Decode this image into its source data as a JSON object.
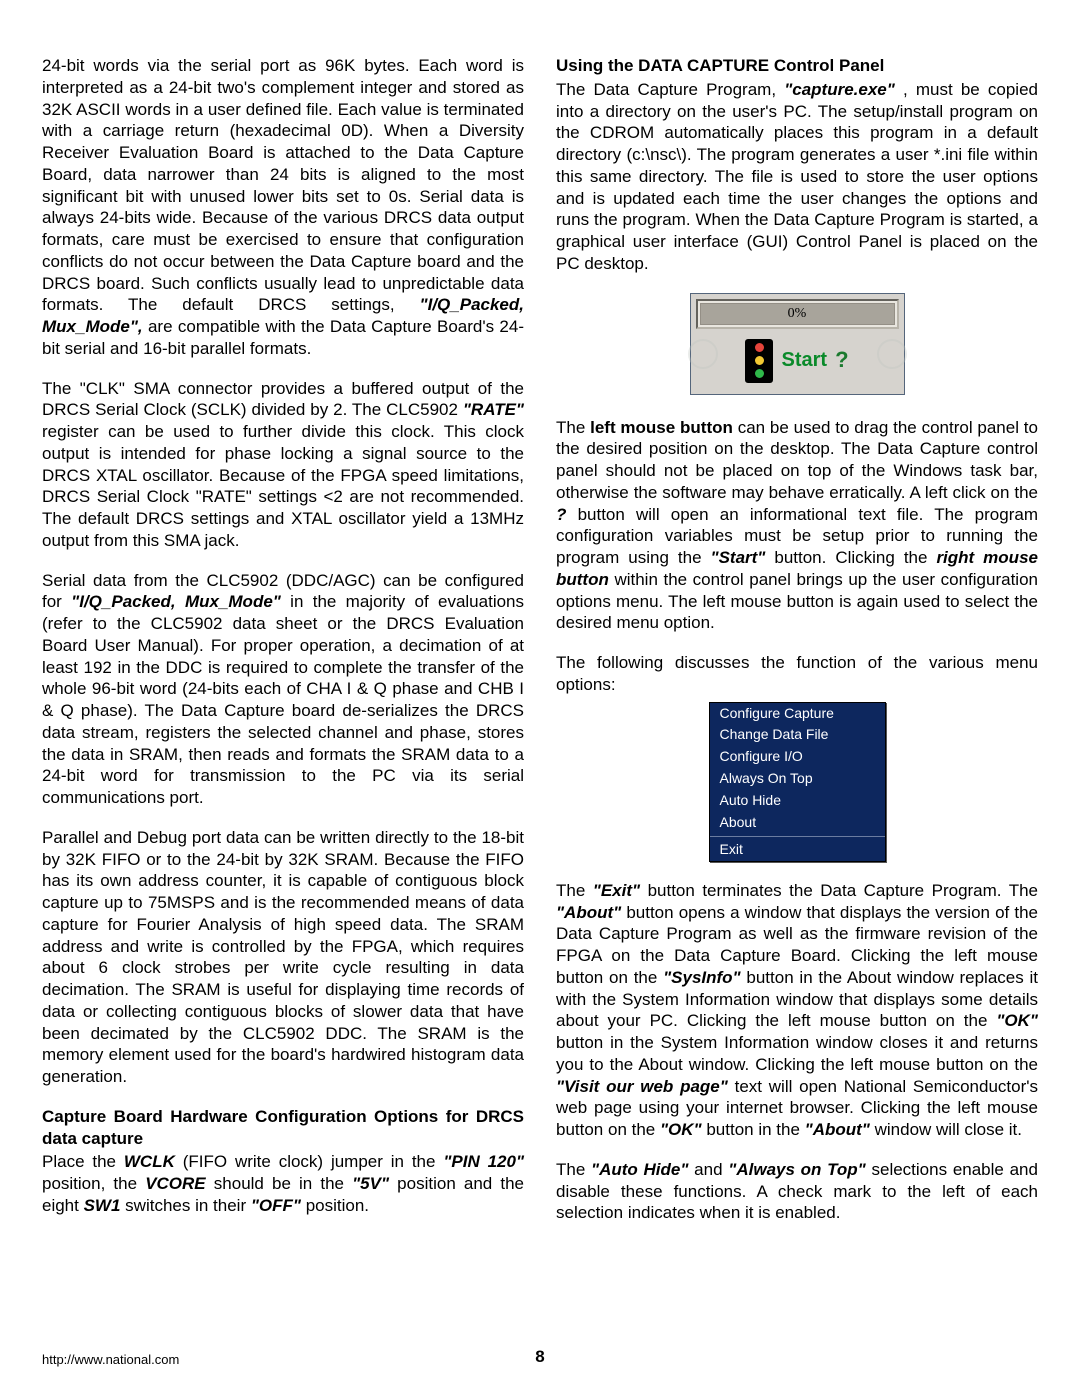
{
  "left": {
    "p1": {
      "t1": "24-bit words via the serial port as 96K bytes. Each word is interpreted as a 24-bit two's complement integer and stored as 32K ASCII words in a user defined file. Each value is terminated with a carriage return (hexadecimal 0D). When a Diversity Receiver Evaluation Board is attached to the Data Capture Board, data narrower than 24 bits is aligned to the most significant bit with unused lower bits set to 0s. Serial data is always 24-bits wide. Because of the various DRCS data output formats, care must be exercised to ensure that configuration conflicts do not occur between the Data Capture board and the DRCS board. Such conflicts usually lead to unpredictable data formats. The default DRCS settings, ",
      "bi1": "\"I/Q_Packed, Mux_Mode\",",
      "t2": " are compatible with the Data Capture Board's 24-bit serial and 16-bit parallel formats."
    },
    "p2": {
      "t1": "The \"CLK\" SMA connector provides a buffered output of the DRCS Serial Clock (SCLK) divided by 2. The CLC5902 ",
      "bi1": "\"RATE\"",
      "t2": " register can be used to further divide this clock. This clock output is intended for phase locking a signal source to the DRCS XTAL oscillator. Because of the FPGA speed limitations, DRCS Serial Clock \"RATE\" settings <2 are not recommended. The default DRCS settings and XTAL oscillator yield a 13MHz output from this SMA jack."
    },
    "p3": {
      "t1": "Serial data from the CLC5902 (DDC/AGC) can be configured for ",
      "bi1": "\"I/Q_Packed, Mux_Mode\"",
      "t2": " in the majority of evaluations (refer to the CLC5902 data sheet or the DRCS Evaluation Board User Manual). For proper operation, a decimation of at least 192 in the DDC is required to complete the transfer of the whole 96-bit word (24-bits each of CHA I & Q phase and CHB I & Q phase). The Data Capture board de-serializes the DRCS data stream, registers the selected channel and phase, stores the data in SRAM, then reads and formats the SRAM data to a 24-bit word for transmission to the PC via its serial communications port."
    },
    "p4": "Parallel and Debug port data can be written directly to the 18-bit by 32K FIFO or to the 24-bit by 32K SRAM. Because the FIFO has its own address counter, it is capable of contiguous block capture up to 75MSPS and is the recommended means of data capture for Fourier Analysis of high speed data. The SRAM address and write is controlled by the FPGA, which requires about 6 clock strobes per write cycle resulting in data decimation. The SRAM is useful for displaying time records of data or collecting contiguous blocks of slower data that have been decimated by the CLC5902 DDC. The SRAM is the memory element used for the board's hardwired histogram data generation.",
    "h1": "Capture Board Hardware Configuration Options for DRCS data capture",
    "p5": {
      "t1": "Place the ",
      "bi1": "WCLK",
      "t2": " (FIFO write clock) jumper in the ",
      "bi2": "\"PIN 120\"",
      "t3": " position, the ",
      "bi3": "VCORE",
      "t4": " should be in the ",
      "bi4": "\"5V\"",
      "t5": " position and the eight ",
      "bi5": "SW1",
      "t6": " switches in their ",
      "bi6": "\"OFF\"",
      "t7": " position."
    }
  },
  "right": {
    "h1": "Using the DATA CAPTURE Control Panel",
    "p1": {
      "t1": "The Data Capture Program, ",
      "bi1": "\"capture.exe\"",
      "t2": ", must be copied into a directory on the user's PC. The setup/install program on the CDROM automatically places this program in a default directory (c:\\nsc\\). The program generates a user *.ini file within this same directory. The file is used to store the user options and is updated each time the user changes the options and runs the program. When the Data Capture Program is started, a graphical user interface (GUI) Control Panel is placed on the PC desktop."
    },
    "panel": {
      "progress": "0%",
      "start": "Start",
      "help": "?"
    },
    "p2": {
      "t1": "The ",
      "b1": "left mouse button",
      "t2": " can be used to drag the control panel to the desired position on the desktop. The Data Capture control panel should not be placed on top of the Windows task bar, otherwise the software may behave erratically. A left click on the ",
      "bi1": "?",
      "t3": " button will open an informational text file. The program configuration variables must be setup prior to running the program using the ",
      "bi2": "\"Start\"",
      "t4": " button. Clicking the ",
      "bi3": "right mouse button",
      "t5": " within the control panel brings up the user configuration options menu. The left mouse button is again used to select the desired menu option."
    },
    "p3": "The following discusses the function of the various menu options:",
    "menu": [
      "Configure Capture",
      "Change Data File",
      "Configure I/O",
      "Always On Top",
      "Auto Hide",
      "About",
      "Exit"
    ],
    "p4": {
      "t1": "The ",
      "bi1": "\"Exit\"",
      "t2": " button terminates the Data Capture Program. The ",
      "bi2": "\"About\"",
      "t3": " button opens a window that displays the version of the Data Capture Program as well as the firmware revision of the FPGA on the Data Capture Board. Clicking the left mouse button on the ",
      "bi3": "\"SysInfo\"",
      "t4": " button in the About window replaces it with the System Information window that displays some details about your PC. Clicking the left mouse button on the ",
      "bi4": "\"OK\"",
      "t5": " button in the System Information window closes it and returns you to the About window. Clicking the left mouse button on the ",
      "bi5": "\"Visit our web page\"",
      "t6": " text will open National Semiconductor's web page using your internet browser. Clicking the left mouse button on the ",
      "bi6": "\"OK\"",
      "t7": " button in the ",
      "bi7": "\"About\"",
      "t8": " window will close it."
    },
    "p5": {
      "t1": "The ",
      "bi1": "\"Auto Hide\"",
      "t2": " and ",
      "bi2": "\"Always on Top\"",
      "t3": " selections enable and disable these functions. A check mark to the left of each selection indicates when it is enabled."
    }
  },
  "footer": {
    "url": "http://www.national.com",
    "page": "8"
  }
}
